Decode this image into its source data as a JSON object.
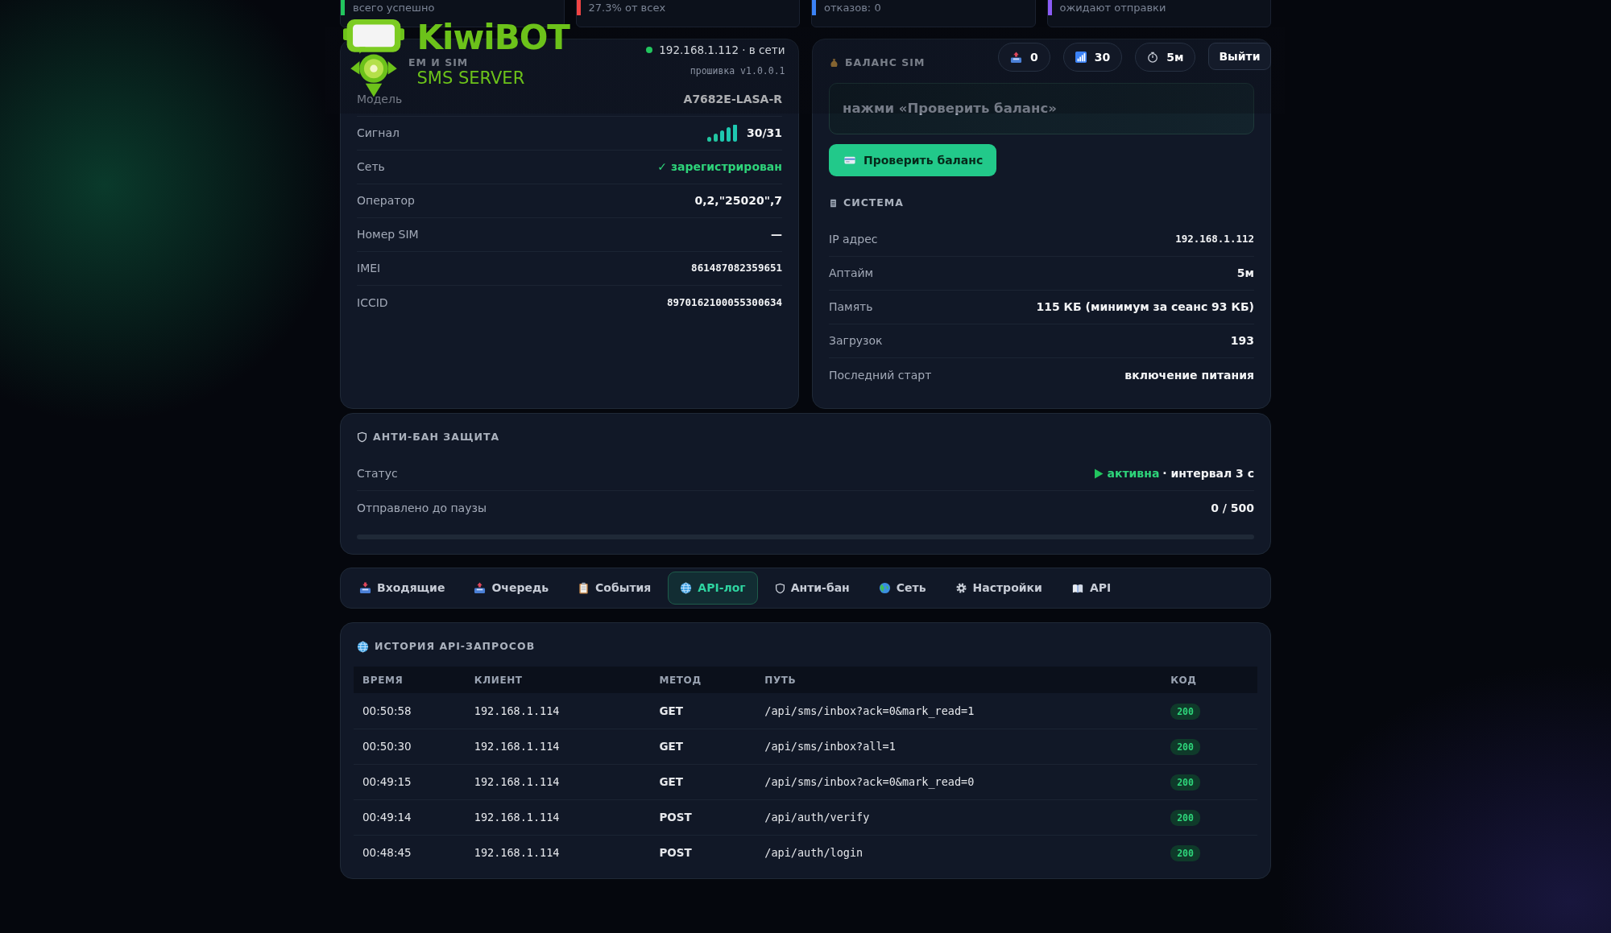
{
  "stat_cards": [
    {
      "caption": "всего успешно",
      "color": "#22c55e"
    },
    {
      "caption": "27.3% от всех",
      "color": "#ef4444"
    },
    {
      "caption": "отказов: 0",
      "color": "#3b82f6"
    },
    {
      "caption": "ожидают отправки",
      "color": "#8b5cf6"
    }
  ],
  "header": {
    "brand": "KiwiBOT",
    "subtitle": "SMS SERVER",
    "host": "192.168.1.112 · в сети",
    "online": true,
    "firmware": "прошивка v1.0.0.1",
    "chips": [
      "0",
      "30",
      "5м"
    ],
    "logout": "Выйти"
  },
  "modem_card": {
    "title": "ЕМ И SIM",
    "rows": [
      {
        "label": "Модель",
        "value": "A7682E-LASA-R",
        "kind": "text"
      },
      {
        "label": "Сигнал",
        "value": "30/31",
        "kind": "signal"
      },
      {
        "label": "Сеть",
        "value": "✓ зарегистрирован",
        "kind": "ok"
      },
      {
        "label": "Оператор",
        "value": "0,2,\"25020\",7",
        "kind": "text"
      },
      {
        "label": "Номер SIM",
        "value": "—",
        "kind": "text"
      },
      {
        "label": "IMEI",
        "value": "861487082359651",
        "kind": "mono"
      },
      {
        "label": "ICCID",
        "value": "8970162100055300634",
        "kind": "mono"
      }
    ]
  },
  "balance_card": {
    "title": "БАЛАНС SIM",
    "message": "нажми «Проверить баланс»",
    "button": "Проверить баланс"
  },
  "system_card": {
    "title": "СИСТЕМА",
    "rows": [
      {
        "label": "IP адрес",
        "value": "192.168.1.112",
        "kind": "mono"
      },
      {
        "label": "Аптайм",
        "value": "5м",
        "kind": "text"
      },
      {
        "label": "Память",
        "value": "115 КБ (минимум за сеанс 93 КБ)",
        "kind": "text"
      },
      {
        "label": "Загрузок",
        "value": "193",
        "kind": "text"
      },
      {
        "label": "Последний старт",
        "value": "включение питания",
        "kind": "text"
      }
    ]
  },
  "antiban": {
    "title": "АНТИ-БАН ЗАЩИТА",
    "status_label": "Статус",
    "active": true,
    "status_text": "активна",
    "interval": "· интервал 3 с",
    "sent_label": "Отправлено до паузы",
    "sent_value": "0 / 500",
    "level": 0
  },
  "tabs": [
    {
      "label": "Входящие",
      "selected": false
    },
    {
      "label": "Очередь",
      "selected": false
    },
    {
      "label": "События",
      "selected": false
    },
    {
      "label": "API-лог",
      "selected": true
    },
    {
      "label": "Анти-бан",
      "selected": false
    },
    {
      "label": "Сеть",
      "selected": false
    },
    {
      "label": "Настройки",
      "selected": false
    },
    {
      "label": "API",
      "selected": false
    }
  ],
  "api_log": {
    "title": "ИСТОРИЯ API-ЗАПРОСОВ",
    "columns": [
      "ВРЕМЯ",
      "КЛИЕНТ",
      "МЕТОД",
      "ПУТЬ",
      "КОД"
    ],
    "rows": [
      {
        "time": "00:50:58",
        "client": "192.168.1.114",
        "method": "GET",
        "path": "/api/sms/inbox?ack=0&mark_read=1",
        "code": "200"
      },
      {
        "time": "00:50:30",
        "client": "192.168.1.114",
        "method": "GET",
        "path": "/api/sms/inbox?all=1",
        "code": "200"
      },
      {
        "time": "00:49:15",
        "client": "192.168.1.114",
        "method": "GET",
        "path": "/api/sms/inbox?ack=0&mark_read=0",
        "code": "200"
      },
      {
        "time": "00:49:14",
        "client": "192.168.1.114",
        "method": "POST",
        "path": "/api/auth/verify",
        "code": "200"
      },
      {
        "time": "00:48:45",
        "client": "192.168.1.114",
        "method": "POST",
        "path": "/api/auth/login",
        "code": "200"
      }
    ]
  }
}
